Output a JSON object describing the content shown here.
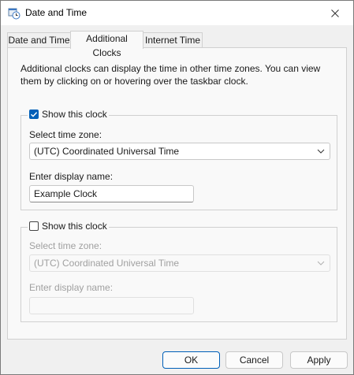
{
  "window": {
    "title": "Date and Time"
  },
  "tabs": [
    {
      "label": "Date and Time"
    },
    {
      "label": "Additional Clocks"
    },
    {
      "label": "Internet Time"
    }
  ],
  "description": "Additional clocks can display the time in other time zones. You can view them by clicking on or hovering over the taskbar clock.",
  "clock1": {
    "show_label": "Show this clock",
    "checked": true,
    "timezone_label": "Select time zone:",
    "timezone_value": "(UTC) Coordinated Universal Time",
    "name_label": "Enter display name:",
    "name_value": "Example Clock"
  },
  "clock2": {
    "show_label": "Show this clock",
    "checked": false,
    "timezone_label": "Select time zone:",
    "timezone_value": "(UTC) Coordinated Universal Time",
    "name_label": "Enter display name:",
    "name_value": ""
  },
  "buttons": {
    "ok": "OK",
    "cancel": "Cancel",
    "apply": "Apply"
  },
  "colors": {
    "accent": "#005fb8"
  }
}
